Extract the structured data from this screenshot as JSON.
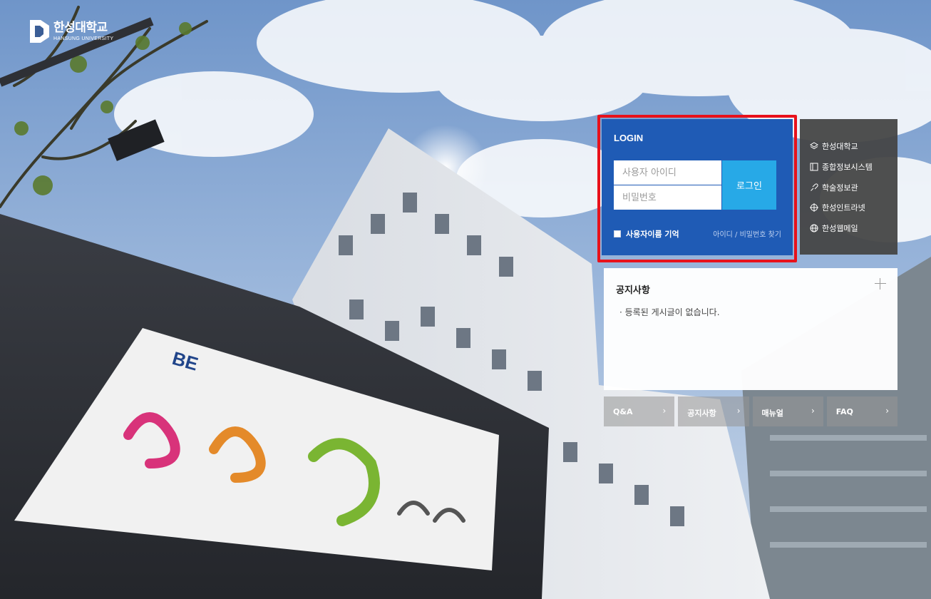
{
  "logo": {
    "name_ko": "한성대학교",
    "name_en": "HANSUNG UNIVERSITY"
  },
  "login": {
    "title": "LOGIN",
    "id_placeholder": "사용자 아이디",
    "pw_placeholder": "비밀번호",
    "button_label": "로그인",
    "remember_label": "사용자이름 기억",
    "find_link": "아이디 / 비밀번호 찾기"
  },
  "quick_links": [
    {
      "label": "한성대학교",
      "icon": "layers-icon"
    },
    {
      "label": "종합정보시스템",
      "icon": "book-icon"
    },
    {
      "label": "학술정보관",
      "icon": "link-icon"
    },
    {
      "label": "한성인트라넷",
      "icon": "crosshair-icon"
    },
    {
      "label": "한성웹메일",
      "icon": "globe-icon"
    }
  ],
  "notice": {
    "title": "공지사항",
    "empty_message": "· 등록된 게시글이 없습니다."
  },
  "tiles": [
    {
      "label": "Q&A",
      "arrow": "›"
    },
    {
      "label": "공지사항",
      "arrow": "›"
    },
    {
      "label": "매뉴얼",
      "arrow": "›"
    },
    {
      "label": "FAQ",
      "arrow": "›"
    }
  ],
  "colors": {
    "login_panel": "#1f5bb5",
    "login_button": "#27a9e7",
    "highlight_outline": "#e8111b",
    "quick_panel": "#444444"
  }
}
